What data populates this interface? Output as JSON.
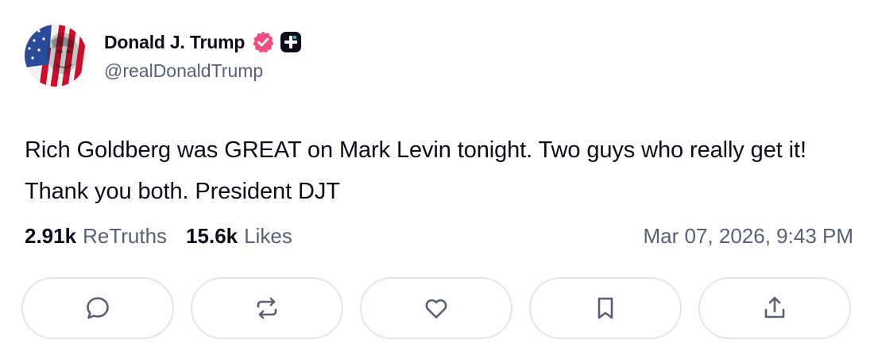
{
  "author": {
    "display_name": "Donald J. Trump",
    "handle": "@realDonaldTrump",
    "avatar_icon": "profile-photo-flag",
    "verified_icon": "verified-badge-icon",
    "verified_color": "#f04e7e",
    "plus_icon": "plus-square-icon"
  },
  "post": {
    "text": "Rich Goldberg was GREAT on Mark Levin tonight. Two guys who really get it! Thank you both. President DJT"
  },
  "stats": {
    "retruths_count": "2.91k",
    "retruths_label": "ReTruths",
    "likes_count": "15.6k",
    "likes_label": "Likes",
    "timestamp": "Mar 07, 2026, 9:43 PM"
  },
  "actions": [
    {
      "name": "reply",
      "icon": "reply-bubble-icon"
    },
    {
      "name": "retruth",
      "icon": "retruth-arrows-icon"
    },
    {
      "name": "like",
      "icon": "heart-icon"
    },
    {
      "name": "bookmark",
      "icon": "bookmark-icon"
    },
    {
      "name": "share",
      "icon": "share-upload-icon"
    }
  ],
  "colors": {
    "text_primary": "#0c0c1a",
    "text_secondary": "#5b5f74",
    "button_border": "#e4e5ea",
    "icon_color": "#5b5f74"
  }
}
